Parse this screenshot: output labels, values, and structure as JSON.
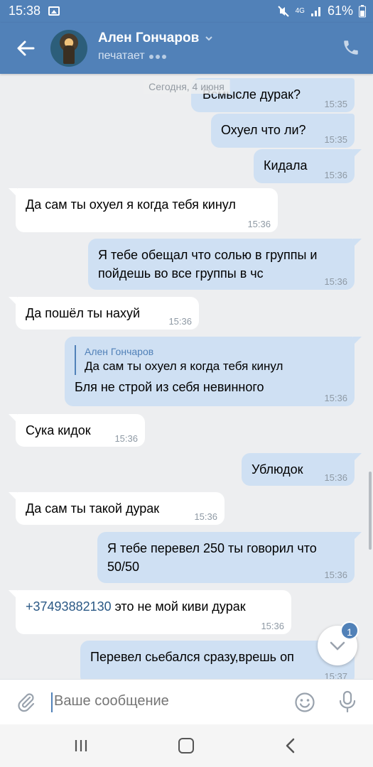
{
  "status_bar": {
    "time": "15:38",
    "network": "4G",
    "battery": "61%"
  },
  "header": {
    "contact_name": "Ален Гончаров",
    "status_text": "печатает"
  },
  "date_separator": "Сегодня, 4 июня",
  "messages": [
    {
      "dir": "out",
      "text": "Всмысле дурак?",
      "time": "15:35"
    },
    {
      "dir": "out",
      "text": "Охуел что ли?",
      "time": "15:35"
    },
    {
      "dir": "out",
      "text": "Кидала",
      "time": "15:36"
    },
    {
      "dir": "in",
      "text": "Да сам ты охуел я когда тебя кинул",
      "time": "15:36"
    },
    {
      "dir": "out",
      "text": "Я тебе обещал что солью в группы и пойдешь во все группы в чс",
      "time": "15:36"
    },
    {
      "dir": "in",
      "text": "Да пошёл ты нахуй",
      "time": "15:36"
    },
    {
      "dir": "out",
      "reply_name": "Ален Гончаров",
      "reply_text": "Да сам ты охуел я когда тебя кинул",
      "text": "Бля не строй из себя невинного",
      "time": "15:36"
    },
    {
      "dir": "in",
      "text": "Сука кидок",
      "time": "15:36"
    },
    {
      "dir": "out",
      "text": "Ублюдок",
      "time": "15:36"
    },
    {
      "dir": "in",
      "text": "Да сам ты такой дурак",
      "time": "15:36"
    },
    {
      "dir": "out",
      "text": "Я тебе перевел 250 ты говорил что 50/50",
      "time": "15:36"
    },
    {
      "dir": "in",
      "link": "+37493882130",
      "text": " это не мой киви дурак",
      "time": "15:36"
    },
    {
      "dir": "out",
      "text": "Перевел сьебался сразу,врешь оп",
      "time": "15:37"
    }
  ],
  "scroll_button": {
    "badge": "1"
  },
  "input": {
    "placeholder": "Ваше сообщение"
  },
  "colors": {
    "accent": "#5181b8",
    "outgoing_bubble": "#cfe0f3",
    "incoming_bubble": "#ffffff",
    "background": "#edeef0"
  }
}
